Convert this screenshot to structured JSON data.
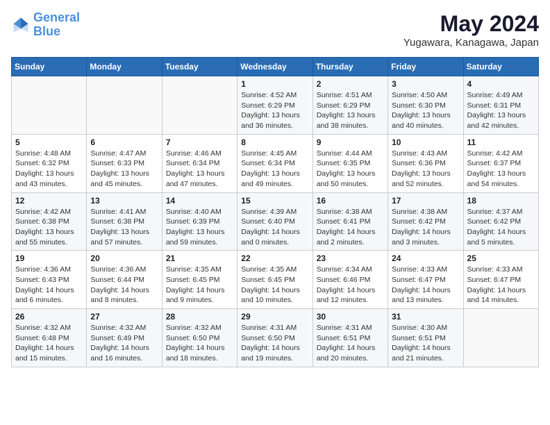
{
  "header": {
    "logo_line1": "General",
    "logo_line2": "Blue",
    "month": "May 2024",
    "location": "Yugawara, Kanagawa, Japan"
  },
  "days_of_week": [
    "Sunday",
    "Monday",
    "Tuesday",
    "Wednesday",
    "Thursday",
    "Friday",
    "Saturday"
  ],
  "weeks": [
    [
      {
        "day": "",
        "info": ""
      },
      {
        "day": "",
        "info": ""
      },
      {
        "day": "",
        "info": ""
      },
      {
        "day": "1",
        "info": "Sunrise: 4:52 AM\nSunset: 6:29 PM\nDaylight: 13 hours\nand 36 minutes."
      },
      {
        "day": "2",
        "info": "Sunrise: 4:51 AM\nSunset: 6:29 PM\nDaylight: 13 hours\nand 38 minutes."
      },
      {
        "day": "3",
        "info": "Sunrise: 4:50 AM\nSunset: 6:30 PM\nDaylight: 13 hours\nand 40 minutes."
      },
      {
        "day": "4",
        "info": "Sunrise: 4:49 AM\nSunset: 6:31 PM\nDaylight: 13 hours\nand 42 minutes."
      }
    ],
    [
      {
        "day": "5",
        "info": "Sunrise: 4:48 AM\nSunset: 6:32 PM\nDaylight: 13 hours\nand 43 minutes."
      },
      {
        "day": "6",
        "info": "Sunrise: 4:47 AM\nSunset: 6:33 PM\nDaylight: 13 hours\nand 45 minutes."
      },
      {
        "day": "7",
        "info": "Sunrise: 4:46 AM\nSunset: 6:34 PM\nDaylight: 13 hours\nand 47 minutes."
      },
      {
        "day": "8",
        "info": "Sunrise: 4:45 AM\nSunset: 6:34 PM\nDaylight: 13 hours\nand 49 minutes."
      },
      {
        "day": "9",
        "info": "Sunrise: 4:44 AM\nSunset: 6:35 PM\nDaylight: 13 hours\nand 50 minutes."
      },
      {
        "day": "10",
        "info": "Sunrise: 4:43 AM\nSunset: 6:36 PM\nDaylight: 13 hours\nand 52 minutes."
      },
      {
        "day": "11",
        "info": "Sunrise: 4:42 AM\nSunset: 6:37 PM\nDaylight: 13 hours\nand 54 minutes."
      }
    ],
    [
      {
        "day": "12",
        "info": "Sunrise: 4:42 AM\nSunset: 6:38 PM\nDaylight: 13 hours\nand 55 minutes."
      },
      {
        "day": "13",
        "info": "Sunrise: 4:41 AM\nSunset: 6:38 PM\nDaylight: 13 hours\nand 57 minutes."
      },
      {
        "day": "14",
        "info": "Sunrise: 4:40 AM\nSunset: 6:39 PM\nDaylight: 13 hours\nand 59 minutes."
      },
      {
        "day": "15",
        "info": "Sunrise: 4:39 AM\nSunset: 6:40 PM\nDaylight: 14 hours\nand 0 minutes."
      },
      {
        "day": "16",
        "info": "Sunrise: 4:38 AM\nSunset: 6:41 PM\nDaylight: 14 hours\nand 2 minutes."
      },
      {
        "day": "17",
        "info": "Sunrise: 4:38 AM\nSunset: 6:42 PM\nDaylight: 14 hours\nand 3 minutes."
      },
      {
        "day": "18",
        "info": "Sunrise: 4:37 AM\nSunset: 6:42 PM\nDaylight: 14 hours\nand 5 minutes."
      }
    ],
    [
      {
        "day": "19",
        "info": "Sunrise: 4:36 AM\nSunset: 6:43 PM\nDaylight: 14 hours\nand 6 minutes."
      },
      {
        "day": "20",
        "info": "Sunrise: 4:36 AM\nSunset: 6:44 PM\nDaylight: 14 hours\nand 8 minutes."
      },
      {
        "day": "21",
        "info": "Sunrise: 4:35 AM\nSunset: 6:45 PM\nDaylight: 14 hours\nand 9 minutes."
      },
      {
        "day": "22",
        "info": "Sunrise: 4:35 AM\nSunset: 6:45 PM\nDaylight: 14 hours\nand 10 minutes."
      },
      {
        "day": "23",
        "info": "Sunrise: 4:34 AM\nSunset: 6:46 PM\nDaylight: 14 hours\nand 12 minutes."
      },
      {
        "day": "24",
        "info": "Sunrise: 4:33 AM\nSunset: 6:47 PM\nDaylight: 14 hours\nand 13 minutes."
      },
      {
        "day": "25",
        "info": "Sunrise: 4:33 AM\nSunset: 6:47 PM\nDaylight: 14 hours\nand 14 minutes."
      }
    ],
    [
      {
        "day": "26",
        "info": "Sunrise: 4:32 AM\nSunset: 6:48 PM\nDaylight: 14 hours\nand 15 minutes."
      },
      {
        "day": "27",
        "info": "Sunrise: 4:32 AM\nSunset: 6:49 PM\nDaylight: 14 hours\nand 16 minutes."
      },
      {
        "day": "28",
        "info": "Sunrise: 4:32 AM\nSunset: 6:50 PM\nDaylight: 14 hours\nand 18 minutes."
      },
      {
        "day": "29",
        "info": "Sunrise: 4:31 AM\nSunset: 6:50 PM\nDaylight: 14 hours\nand 19 minutes."
      },
      {
        "day": "30",
        "info": "Sunrise: 4:31 AM\nSunset: 6:51 PM\nDaylight: 14 hours\nand 20 minutes."
      },
      {
        "day": "31",
        "info": "Sunrise: 4:30 AM\nSunset: 6:51 PM\nDaylight: 14 hours\nand 21 minutes."
      },
      {
        "day": "",
        "info": ""
      }
    ]
  ]
}
